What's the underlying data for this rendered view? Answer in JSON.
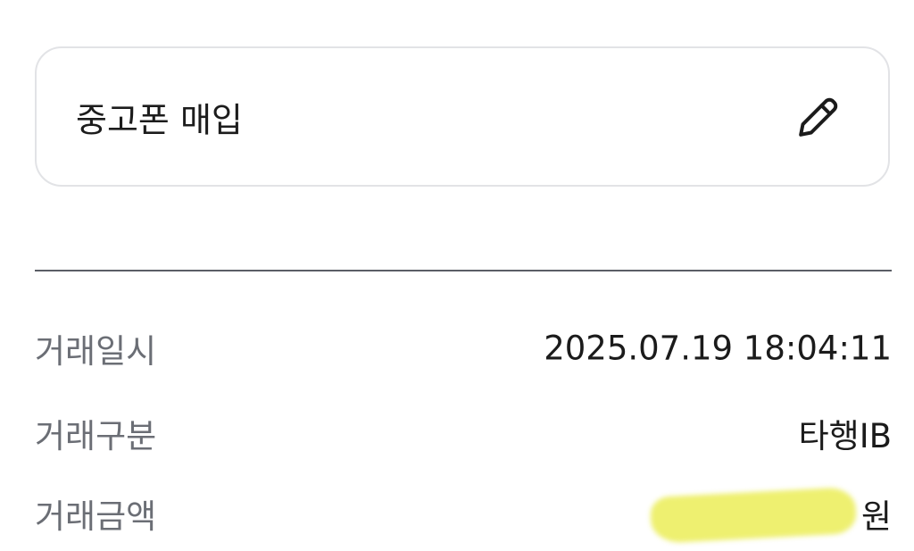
{
  "memo": {
    "text": "중고폰 매입",
    "edit_icon": "pencil-icon"
  },
  "details": {
    "rows": [
      {
        "label": "거래일시",
        "value": "2025.07.19 18:04:11"
      },
      {
        "label": "거래구분",
        "value": "타행IB"
      },
      {
        "label": "거래금액",
        "currency": "원",
        "highlight_color": "#eef070"
      }
    ]
  },
  "colors": {
    "card_border": "#e2e3e6",
    "divider": "#5b5e66",
    "label_text": "#6b6e75",
    "value_text": "#1b1b1b"
  }
}
